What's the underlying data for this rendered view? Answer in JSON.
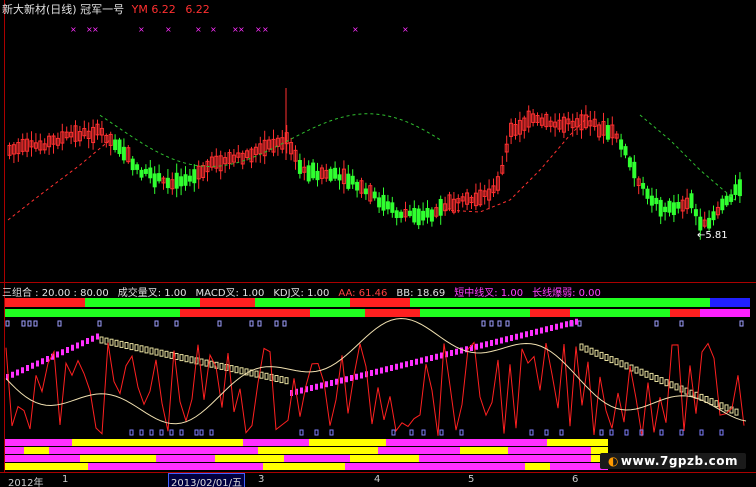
{
  "header": {
    "title": "新大新材(日线)",
    "indicator_name": "冠军一号",
    "ym_label": "YM",
    "ym_value1": "6.22",
    "ym_value2": "6.22"
  },
  "indicator_bar": {
    "items": [
      {
        "label": "三组合 : 20.00 : 80.00",
        "color": "#e0e0e0"
      },
      {
        "label": "成交量叉: 1.00",
        "color": "#e0e0e0"
      },
      {
        "label": "MACD叉: 1.00",
        "color": "#e0e0e0"
      },
      {
        "label": "KDJ叉: 1.00",
        "color": "#e0e0e0"
      },
      {
        "label": "AA: 61.46",
        "color": "#ff4040"
      },
      {
        "label": "BB: 18.69",
        "color": "#e0e0e0"
      },
      {
        "label": "短中线叉: 1.00",
        "color": "#ff40ff"
      },
      {
        "label": "长线爆弱: 0.00",
        "color": "#ff40ff"
      }
    ]
  },
  "annotations": {
    "low_price": "←5.81"
  },
  "time_axis": {
    "labels": [
      {
        "text": "2012年"
      },
      {
        "text": "1"
      },
      {
        "text": "3"
      },
      {
        "text": "4"
      },
      {
        "text": "5"
      },
      {
        "text": "6"
      }
    ],
    "cursor_date": "2013/02/01/五"
  },
  "watermark": {
    "text": "www.7gpzb.com",
    "logo": "◐"
  },
  "colors": {
    "up": "#ff3030",
    "down": "#30ff30",
    "ma_dash": "#30c030",
    "ma_red": "#ff3030",
    "magenta": "#ff30ff",
    "yellow": "#ffff00",
    "white_line": "#f0e0b0",
    "grid": "#aa0000"
  }
}
